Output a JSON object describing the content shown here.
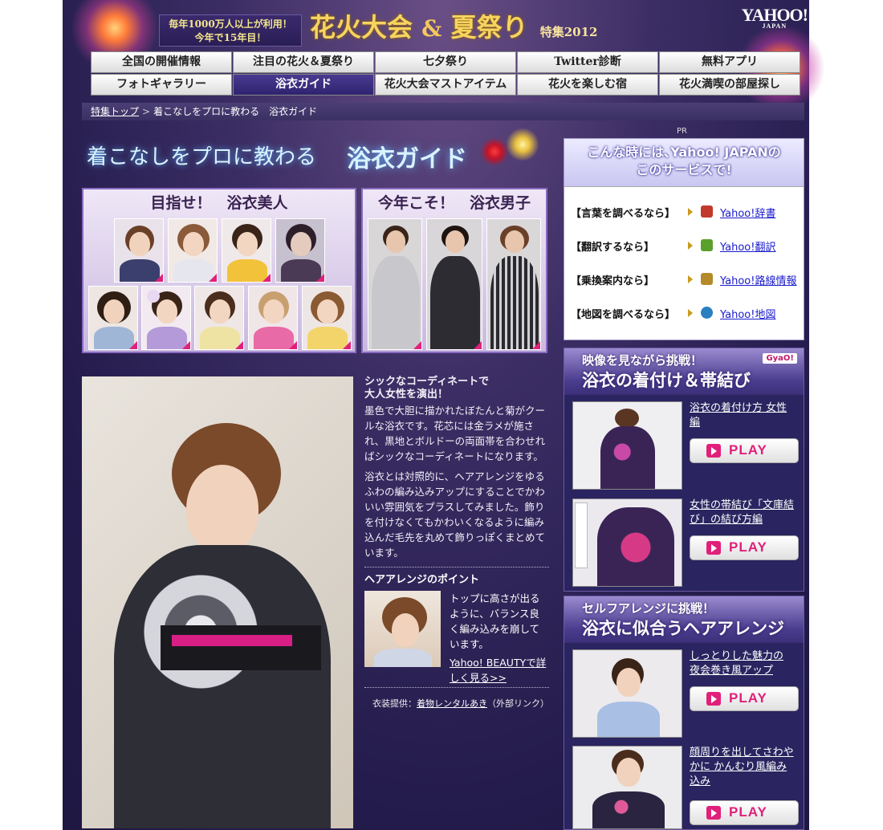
{
  "header": {
    "promo_line1": "毎年1000万人以上が利用！",
    "promo_line2": "今年で15年目！",
    "title_part1": "花火大会",
    "title_amp": "&",
    "title_part2": "夏祭り",
    "title_suffix": "特集2012",
    "logo_text": "YAHOO!",
    "logo_sub": "JAPAN"
  },
  "nav": {
    "items": [
      {
        "label": "全国の開催情報"
      },
      {
        "label": "注目の花火＆夏祭り"
      },
      {
        "label": "七夕祭り"
      },
      {
        "label": "Twitter診断"
      },
      {
        "label": "無料アプリ"
      },
      {
        "label": "フォトギャラリー"
      },
      {
        "label": "浴衣ガイド"
      },
      {
        "label": "花火大会マストアイテム"
      },
      {
        "label": "花火を楽しむ宿"
      },
      {
        "label": "花火満喫の部屋探し"
      }
    ],
    "active_index": 6
  },
  "breadcrumb": {
    "home": "特集トップ",
    "current": "着こなしをプロに教わる　浴衣ガイド"
  },
  "heading": {
    "left": "着こなしをプロに教わる",
    "right": "浴衣ガイド"
  },
  "gallery": {
    "women_title": "目指せ！　浴衣美人",
    "men_title": "今年こそ！　浴衣男子"
  },
  "article": {
    "lead1": "シックなコーディネートで",
    "lead2": "大人女性を演出！",
    "para1": "墨色で大胆に描かれたぼたんと菊がクールな浴衣です。花芯には金ラメが施され、黒地とボルドーの両面帯を合わせればシックなコーディネートになります。",
    "para2": "浴衣とは対照的に、ヘアアレンジをゆるふわの編み込みアップにすることでかわいい雰囲気をプラスしてみました。飾りを付けなくてもかわいくなるように編み込んだ毛先を丸めて飾りっぽくまとめています。",
    "point_title": "ヘアアレンジのポイント",
    "point_text": "トップに高さが出るように、バランス良く編み込みを崩しています。",
    "point_link": "Yahoo! BEAUTYで詳しく見る>>",
    "credit_prefix": "衣装提供：",
    "credit_link": "着物レンタルあき",
    "credit_suffix": "（外部リンク）"
  },
  "services": {
    "pr_label": "PR",
    "head_line1": "こんな時には､Yahoo! JAPANの",
    "head_line2": "このサービスで!",
    "rows": [
      {
        "label": "【言葉を調べるなら】",
        "link": "Yahoo!辞書",
        "icon": "dictionary-icon",
        "color": "#c0392b"
      },
      {
        "label": "【翻訳するなら】",
        "link": "Yahoo!翻訳",
        "icon": "translate-icon",
        "color": "#5aa02c"
      },
      {
        "label": "【乗換案内なら】",
        "link": "Yahoo!路線情報",
        "icon": "train-icon",
        "color": "#b58a2a"
      },
      {
        "label": "【地図を調べるなら】",
        "link": "Yahoo!地図",
        "icon": "globe-icon",
        "color": "#2a7fc0"
      }
    ]
  },
  "obi_section": {
    "banner_line1": "映像を見ながら挑戦！",
    "banner_line2": "浴衣の着付け＆帯結び",
    "badge": "GyaO!",
    "videos": [
      {
        "title": "浴衣の着付け方  女性編",
        "play": "PLAY"
      },
      {
        "title": "女性の帯結び「文庫結び」の結び方編",
        "play": "PLAY"
      }
    ]
  },
  "hair_section": {
    "banner_line1": "セルフアレンジに挑戦！",
    "banner_line2": "浴衣に似合うヘアアレンジ",
    "videos": [
      {
        "title": "しっとりした魅力の 夜会巻き風アップ",
        "play": "PLAY"
      },
      {
        "title": "顔周りを出してさわやかに かんむり風編み込み",
        "play": "PLAY"
      }
    ]
  }
}
